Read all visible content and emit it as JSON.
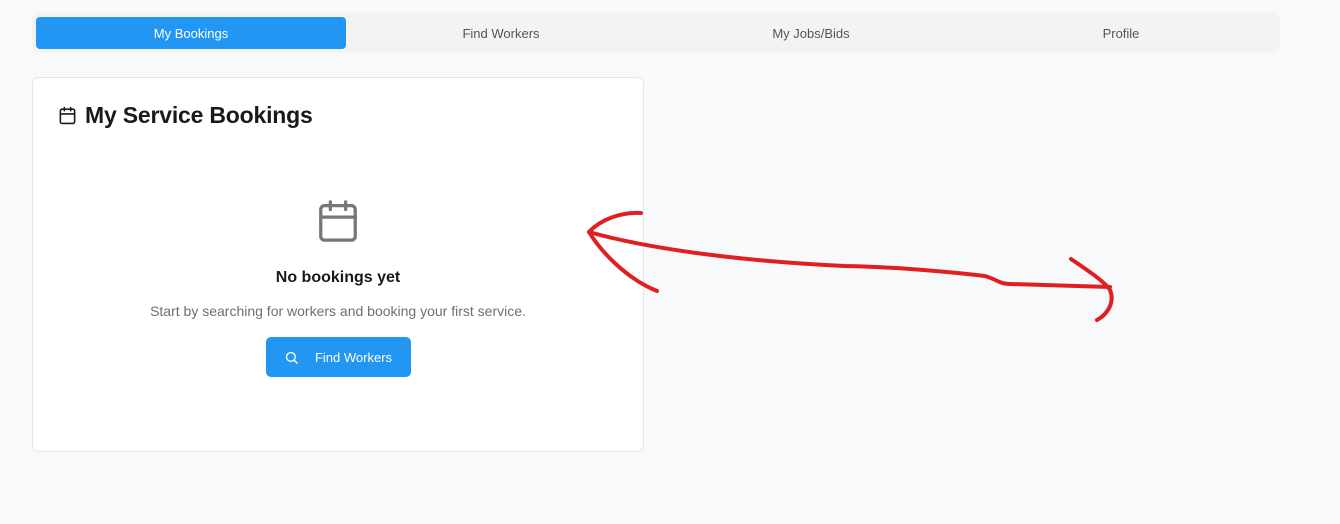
{
  "tabs": [
    {
      "label": "My Bookings",
      "active": true
    },
    {
      "label": "Find Workers",
      "active": false
    },
    {
      "label": "My Jobs/Bids",
      "active": false
    },
    {
      "label": "Profile",
      "active": false
    }
  ],
  "card": {
    "title": "My Service Bookings",
    "title_icon": "calendar-icon",
    "empty_icon": "calendar-icon",
    "empty_title": "No bookings yet",
    "empty_description": "Start by searching for workers and booking your first service.",
    "button_label": "Find Workers",
    "button_icon": "search-icon"
  },
  "annotation": {
    "type": "hand-drawn double-headed arrow",
    "color": "#e02020"
  },
  "colors": {
    "accent": "#2196f3",
    "background": "#f8f9fb",
    "tabbar": "#f3f3f1"
  }
}
